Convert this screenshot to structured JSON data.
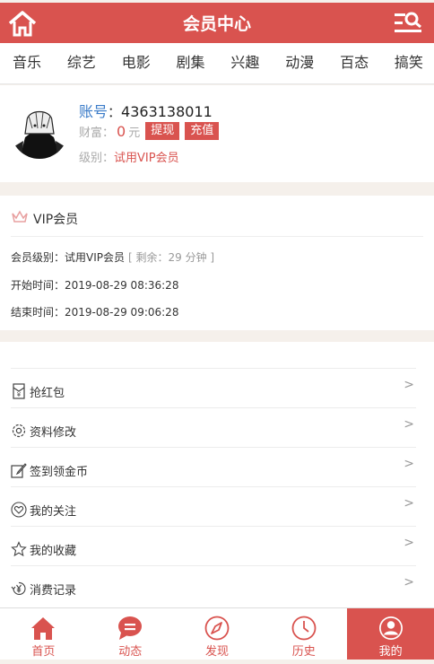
{
  "header": {
    "title": "会员中心",
    "home_icon": "home-icon",
    "menu_icon": "menu-search-icon"
  },
  "categories": [
    "音乐",
    "综艺",
    "电影",
    "剧集",
    "兴趣",
    "动漫",
    "百态",
    "搞笑"
  ],
  "profile": {
    "account_label": "账号",
    "account_sep": "：",
    "account_value": "4363138011",
    "wealth_label": "财富：",
    "wealth_value": "0",
    "wealth_unit": "元",
    "withdraw_button": "提现",
    "recharge_button": "充值",
    "level_label": "级别：",
    "level_value": "试用VIP会员"
  },
  "vip": {
    "title": "VIP会员",
    "level_row": "会员级别：试用VIP会员",
    "remaining": "[ 剩余：29 分钟 ]",
    "start_row": "开始时间：2019-08-29 08:36:28",
    "end_row": "结束时间：2019-08-29 09:06:28"
  },
  "menu": [
    {
      "label": "抢红包",
      "icon": "red-packet-icon",
      "arrow": ">"
    },
    {
      "label": "资料修改",
      "icon": "gear-icon",
      "arrow": ">"
    },
    {
      "label": "签到领金币",
      "icon": "edit-icon",
      "arrow": ">"
    },
    {
      "label": "我的关注",
      "icon": "heart-icon",
      "arrow": ">"
    },
    {
      "label": "我的收藏",
      "icon": "star-icon",
      "arrow": ">"
    },
    {
      "label": "消费记录",
      "icon": "yen-icon",
      "arrow": ">"
    }
  ],
  "tabs": [
    {
      "label": "首页",
      "icon": "home-icon"
    },
    {
      "label": "动态",
      "icon": "chat-icon"
    },
    {
      "label": "发现",
      "icon": "compass-icon"
    },
    {
      "label": "历史",
      "icon": "clock-icon"
    },
    {
      "label": "我的",
      "icon": "user-icon",
      "active": true
    }
  ],
  "colors": {
    "accent": "#d9534f",
    "link": "#3a7bc8",
    "background": "#f5f0eb"
  }
}
